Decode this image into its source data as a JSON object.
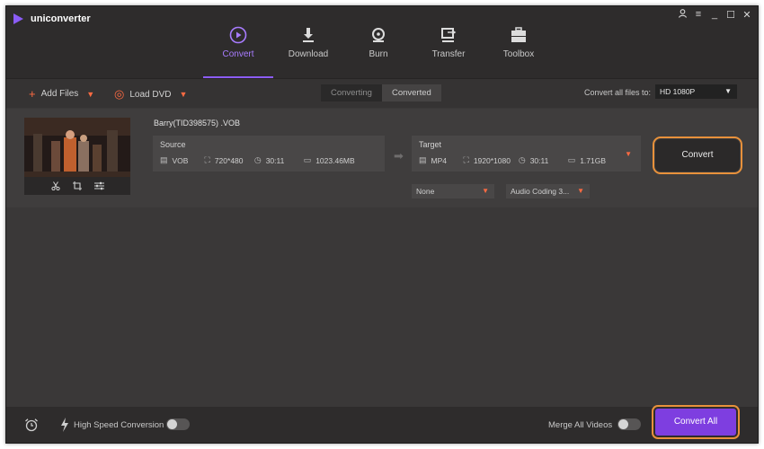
{
  "app": {
    "title": "uniconverter"
  },
  "nav": {
    "tabs": [
      {
        "label": "Convert",
        "icon": "convert-icon",
        "active": true
      },
      {
        "label": "Download",
        "icon": "download-icon"
      },
      {
        "label": "Burn",
        "icon": "burn-icon"
      },
      {
        "label": "Transfer",
        "icon": "transfer-icon"
      },
      {
        "label": "Toolbox",
        "icon": "toolbox-icon"
      }
    ]
  },
  "toolbar": {
    "add_files": "Add Files",
    "load_dvd": "Load DVD",
    "segment": {
      "converting": "Converting",
      "converted": "Converted"
    },
    "convert_all_label": "Convert all files to:",
    "convert_all_value": "HD 1080P"
  },
  "item": {
    "filename": "Barry(TID398575) .VOB",
    "source": {
      "label": "Source",
      "format": "VOB",
      "resolution": "720*480",
      "duration": "30:11",
      "size": "1023.46MB"
    },
    "target": {
      "label": "Target",
      "format": "MP4",
      "resolution": "1920*1080",
      "duration": "30:11",
      "size": "1.71GB"
    },
    "subtitle_select": "None",
    "audio_select": "Audio Coding 3...",
    "convert_button": "Convert"
  },
  "bottom": {
    "high_speed": "High Speed Conversion",
    "merge": "Merge All Videos",
    "convert_all": "Convert All"
  },
  "colors": {
    "accent_purple": "#8b5cf6",
    "accent_orange": "#ff6b42",
    "highlight_outline": "#e8913b"
  }
}
